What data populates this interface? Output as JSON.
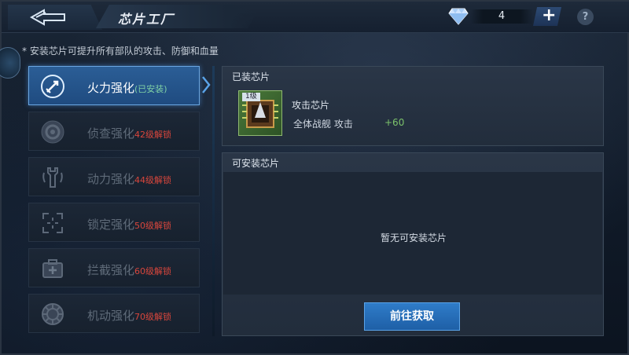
{
  "header": {
    "title": "芯片工厂",
    "gem_count": "4",
    "add_label": "+",
    "help_label": "?"
  },
  "tip": "* 安装芯片可提升所有部队的攻击、防御和血量",
  "menu": {
    "items": [
      {
        "label": "火力强化",
        "suffix": "(已安装)",
        "icon": "missile-icon",
        "active": true
      },
      {
        "label": "侦查强化",
        "suffix": "42级解锁",
        "icon": "radar-icon",
        "active": false
      },
      {
        "label": "动力强化",
        "suffix": "44级解锁",
        "icon": "wrench-icon",
        "active": false
      },
      {
        "label": "锁定强化",
        "suffix": "50级解锁",
        "icon": "target-bracket-icon",
        "active": false
      },
      {
        "label": "拦截强化",
        "suffix": "60级解锁",
        "icon": "medkit-icon",
        "active": false
      },
      {
        "label": "机动强化",
        "suffix": "70级解锁",
        "icon": "gear-wheel-icon",
        "active": false
      }
    ]
  },
  "installed": {
    "title": "已装芯片",
    "chip": {
      "level": "1级",
      "name": "攻击芯片",
      "stat": "全体战舰  攻击",
      "bonus": "+60"
    }
  },
  "available": {
    "title": "可安装芯片",
    "empty_text": "暂无可安装芯片",
    "button_label": "前往获取"
  },
  "colors": {
    "active_blue": "#2b5e96",
    "locked_red": "#d9463c",
    "installed_green": "#7fd0a5",
    "bonus_green": "#7cc26b"
  }
}
